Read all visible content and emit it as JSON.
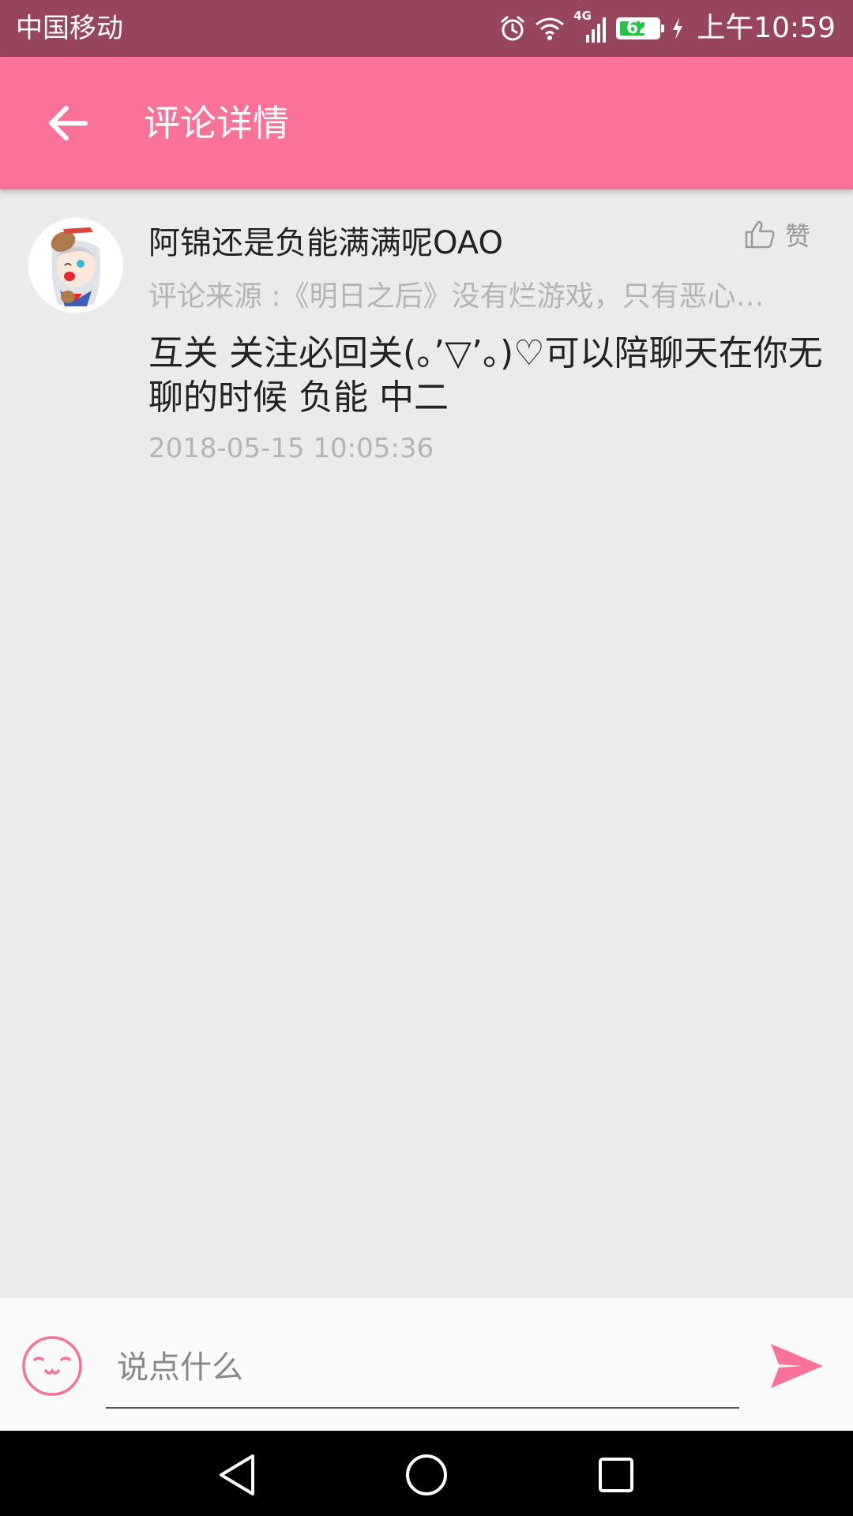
{
  "status_bar": {
    "carrier": "中国移动",
    "network": "4G",
    "battery": "62",
    "time": "上午10:59"
  },
  "header": {
    "title": "评论详情",
    "back_icon": "arrow-left-icon"
  },
  "comment": {
    "username": "阿锦还是负能满满呢OAO",
    "like_label": "赞",
    "source": "评论来源 :《明日之后》没有烂游戏，只有恶心…",
    "content": "互关 关注必回关(。’▽’。)♡可以陪聊天在你无聊的时候 负能 中二",
    "timestamp": "2018-05-15 10:05:36"
  },
  "input_bar": {
    "placeholder": "说点什么",
    "value": ""
  },
  "colors": {
    "status_bar": "#97455c",
    "accent": "#fb7299",
    "background": "#ebebeb",
    "secondary_text": "#b4b4b4"
  }
}
